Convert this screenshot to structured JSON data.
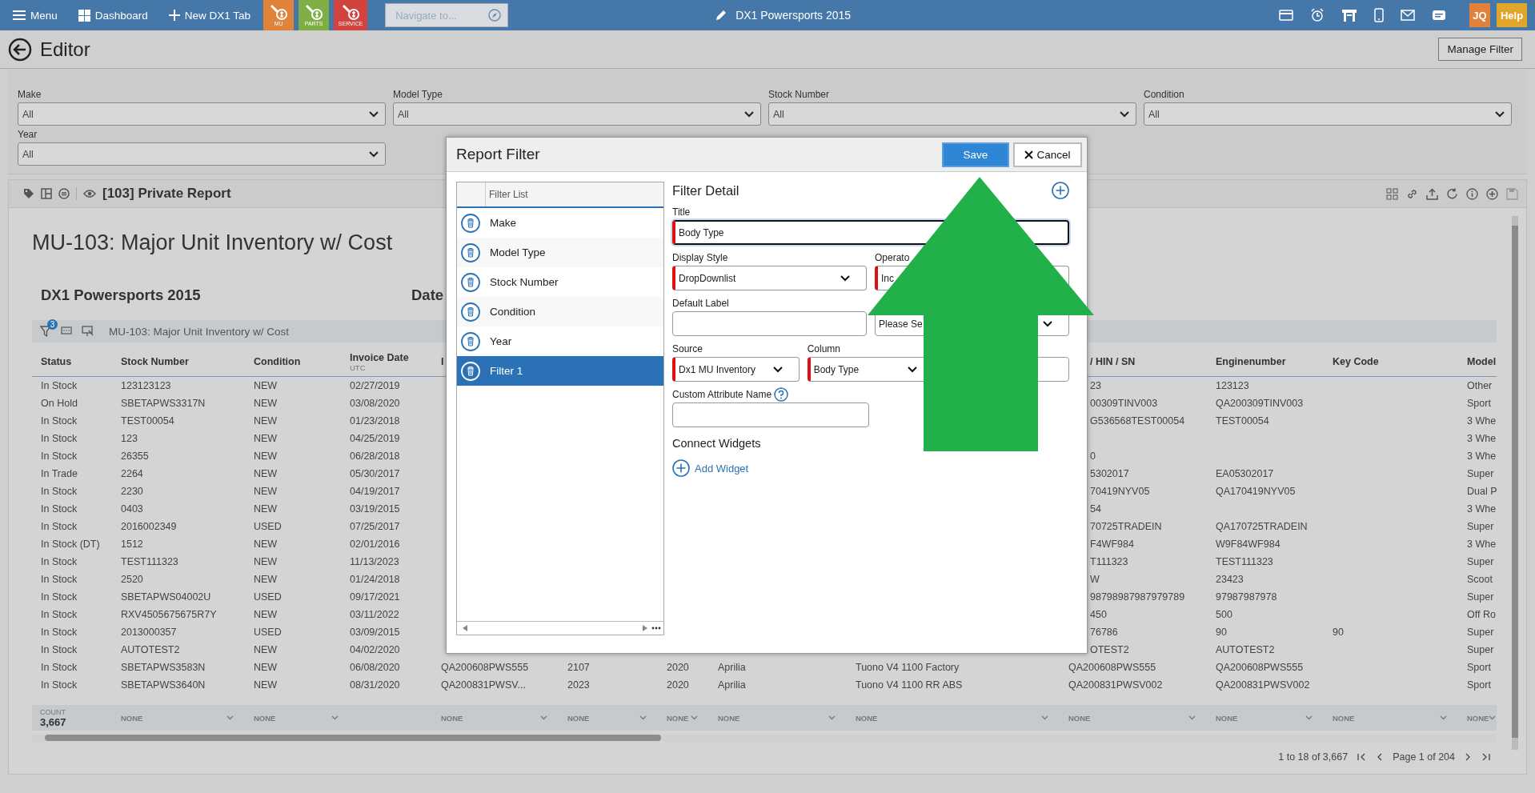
{
  "top_bar": {
    "menu": "Menu",
    "dashboard": "Dashboard",
    "new_tab": "New DX1 Tab",
    "tiles": [
      {
        "label": "MU",
        "color": "#e0823a"
      },
      {
        "label": "PARTS",
        "color": "#7fae45"
      },
      {
        "label": "SERVICE",
        "color": "#d2433f"
      }
    ],
    "navigate": {
      "placeholder": "Navigate to..."
    },
    "title": "DX1 Powersports 2015",
    "user": "JQ",
    "help": "Help"
  },
  "page": {
    "title": "Editor",
    "manage_filter": "Manage Filter"
  },
  "filters": [
    {
      "label": "Make",
      "value": "All"
    },
    {
      "label": "Model Type",
      "value": "All"
    },
    {
      "label": "Stock Number",
      "value": "All"
    },
    {
      "label": "Condition",
      "value": "All"
    },
    {
      "label": "Year",
      "value": "All"
    }
  ],
  "report": {
    "name": "[103] Private Report",
    "title": "MU-103: Major Unit Inventory w/ Cost",
    "company": "DX1 Powersports 2015",
    "date_label": "Date"
  },
  "grid": {
    "filter_count": "3",
    "title": "MU-103: Major Unit Inventory w/ Cost",
    "columns": [
      {
        "label": "Status"
      },
      {
        "label": "Stock Number"
      },
      {
        "label": "Condition"
      },
      {
        "label": "Invoice Date",
        "sub": "UTC"
      },
      {
        "label": "I"
      },
      null,
      null,
      null,
      null,
      {
        "label": "/ HIN / SN",
        "covered": true
      },
      {
        "label": "Enginenumber"
      },
      {
        "label": "Key Code"
      },
      {
        "label": "Model"
      }
    ],
    "rows": [
      {
        "covered": true,
        "cells": [
          "In Stock",
          "123123123",
          "NEW",
          "02/27/2019",
          null,
          null,
          null,
          null,
          null,
          "23",
          "123123",
          null,
          "Other"
        ]
      },
      {
        "covered": true,
        "cells": [
          "On Hold",
          "SBETAPWS3317N",
          "NEW",
          "03/08/2020",
          null,
          null,
          null,
          null,
          null,
          "00309TINV003",
          "QA200309TINV003",
          null,
          "Sport"
        ]
      },
      {
        "covered": true,
        "cells": [
          "In Stock",
          "TEST00054",
          "NEW",
          "01/23/2018",
          null,
          null,
          null,
          null,
          null,
          "G536568TEST00054",
          "TEST00054",
          null,
          "3 Whe"
        ]
      },
      {
        "cells": [
          "In Stock",
          "123",
          "NEW",
          "04/25/2019",
          null,
          null,
          null,
          null,
          null,
          null,
          null,
          null,
          "3 Whe"
        ]
      },
      {
        "covered": true,
        "cells": [
          "In Stock",
          "26355",
          "NEW",
          "06/28/2018",
          null,
          null,
          null,
          null,
          null,
          "0",
          null,
          null,
          "3 Whe"
        ]
      },
      {
        "covered": true,
        "cells": [
          "In Trade",
          "2264",
          "NEW",
          "05/30/2017",
          null,
          null,
          null,
          null,
          null,
          "5302017",
          "EA05302017",
          null,
          "Super"
        ]
      },
      {
        "covered": true,
        "cells": [
          "In Stock",
          "2230",
          "NEW",
          "04/19/2017",
          null,
          null,
          null,
          null,
          null,
          "70419NYV05",
          "QA170419NYV05",
          null,
          "Dual P"
        ]
      },
      {
        "covered": true,
        "cells": [
          "In Stock",
          "0403",
          "NEW",
          "03/19/2015",
          null,
          null,
          null,
          null,
          null,
          "54",
          null,
          null,
          "3 Whe"
        ]
      },
      {
        "covered": true,
        "cells": [
          "In Stock",
          "2016002349",
          "USED",
          "07/25/2017",
          null,
          null,
          null,
          null,
          null,
          "70725TRADEIN",
          "QA170725TRADEIN",
          null,
          "Super"
        ]
      },
      {
        "covered": true,
        "cells": [
          "In Stock (DT)",
          "1512",
          "NEW",
          "02/01/2016",
          null,
          null,
          null,
          null,
          null,
          "F4WF984",
          "W9F84WF984",
          null,
          "3 Whe"
        ]
      },
      {
        "covered": true,
        "cells": [
          "In Stock",
          "TEST111323",
          "NEW",
          "11/13/2023",
          null,
          null,
          null,
          null,
          null,
          "T111323",
          "TEST111323",
          null,
          "Super"
        ]
      },
      {
        "covered": true,
        "cells": [
          "In Stock",
          "2520",
          "NEW",
          "01/24/2018",
          null,
          null,
          null,
          null,
          null,
          "W",
          "23423",
          null,
          "Scoot"
        ]
      },
      {
        "covered": true,
        "cells": [
          "In Stock",
          "SBETAPWS04002U",
          "USED",
          "09/17/2021",
          null,
          null,
          null,
          null,
          null,
          "98798987987979789",
          "97987987978",
          null,
          "Super"
        ]
      },
      {
        "covered": true,
        "cells": [
          "In Stock",
          "RXV4505675675R7Y",
          "NEW",
          "03/11/2022",
          null,
          null,
          null,
          null,
          null,
          "450",
          "500",
          null,
          "Off Ro"
        ]
      },
      {
        "covered": true,
        "cells": [
          "In Stock",
          "2013000357",
          "USED",
          "03/09/2015",
          null,
          null,
          null,
          null,
          null,
          "76786",
          "90",
          "90",
          "Super"
        ]
      },
      {
        "covered": true,
        "cells": [
          "In Stock",
          "AUTOTEST2",
          "NEW",
          "04/02/2020",
          null,
          null,
          null,
          null,
          null,
          "OTEST2",
          "AUTOTEST2",
          null,
          "Super"
        ]
      },
      {
        "covered": false,
        "cells": [
          "In Stock",
          "SBETAPWS3583N",
          "NEW",
          "06/08/2020",
          "QA200608PWS555",
          "2107",
          "2020",
          "Aprilia",
          "Tuono V4 1100 Factory",
          "QA200608PWS555",
          "QA200608PWS555",
          null,
          "Sport"
        ]
      },
      {
        "covered": false,
        "cells": [
          "In Stock",
          "SBETAPWS3640N",
          "NEW",
          "08/31/2020",
          "QA200831PWSV...",
          "2023",
          "2020",
          "Aprilia",
          "Tuono V4 1100 RR ABS",
          "QA200831PWSV002",
          "QA200831PWSV002",
          null,
          "Sport"
        ]
      }
    ],
    "aggregates": [
      {
        "label": "COUNT",
        "value": "3,667"
      },
      {
        "value": "NONE"
      },
      {
        "value": "NONE"
      },
      {
        "value": "NONE"
      },
      {
        "value": "NONE"
      },
      {
        "value": "NONE"
      },
      {
        "value": "NONE"
      },
      {
        "value": "NONE"
      },
      {
        "value": "NONE"
      },
      {
        "value": "NONE"
      },
      {
        "value": "NONE"
      },
      {
        "value": "NONE"
      }
    ],
    "pagination": {
      "range": "1 to 18 of 3,667",
      "page": "Page 1 of 204"
    }
  },
  "report_filter": {
    "title": "Report Filter",
    "save": "Save",
    "cancel": "Cancel",
    "list_header": "Filter List",
    "items": [
      {
        "label": "Make",
        "selected": false
      },
      {
        "label": "Model Type",
        "selected": false
      },
      {
        "label": "Stock Number",
        "selected": false
      },
      {
        "label": "Condition",
        "selected": false
      },
      {
        "label": "Year",
        "selected": false
      },
      {
        "label": "Filter 1",
        "selected": true
      }
    ],
    "detail_title": "Filter Detail",
    "field_rows": [
      [
        {
          "kind": "text",
          "label": "Title",
          "value": "Body Type",
          "required": true,
          "focused": true
        }
      ],
      [
        {
          "kind": "select",
          "label": "Display Style",
          "value": "DropDownlist",
          "required": true
        },
        {
          "kind": "select",
          "label": "Operato",
          "value": "Inc",
          "required": true
        }
      ],
      [
        {
          "kind": "text",
          "label": "Default Label",
          "required": false
        },
        {
          "kind": "select",
          "value": "Please Se",
          "required": false
        }
      ],
      [
        {
          "kind": "select",
          "label": "Source",
          "value": "Dx1 MU Inventory",
          "required": true
        },
        {
          "kind": "select",
          "label": "Column",
          "value": "Body Type",
          "required": true
        },
        {
          "kind": "select"
        }
      ],
      [
        {
          "kind": "text",
          "label": "Custom Attribute Name",
          "help": true,
          "required": false
        }
      ]
    ],
    "widgets_title": "Connect Widgets",
    "add_widget": "Add Widget"
  }
}
